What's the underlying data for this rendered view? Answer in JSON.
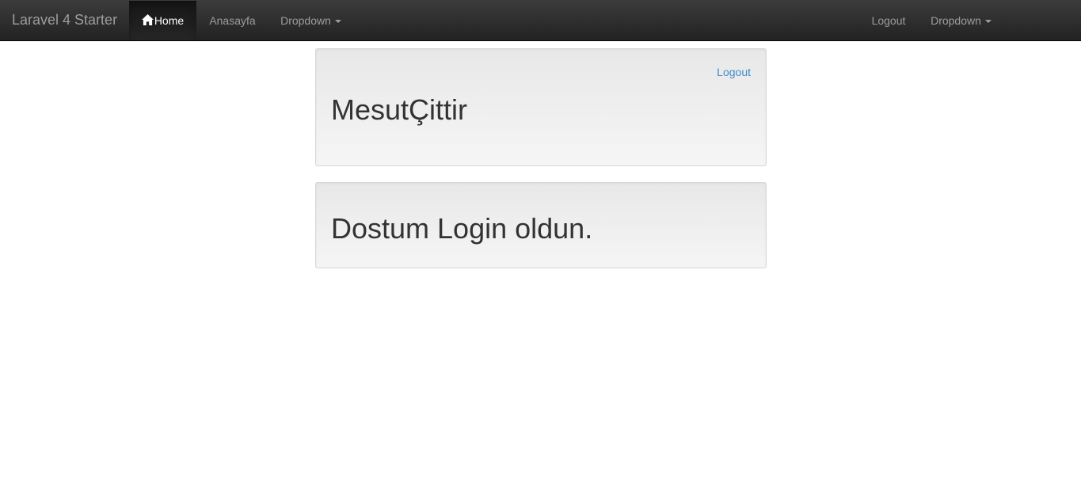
{
  "navbar": {
    "brand": "Laravel 4 Starter",
    "left_items": [
      {
        "label": "Home",
        "icon": "home-icon",
        "active": true
      },
      {
        "label": "Anasayfa"
      },
      {
        "label": "Dropdown",
        "has_caret": true
      }
    ],
    "right_items": [
      {
        "label": "Logout"
      },
      {
        "label": "Dropdown",
        "has_caret": true
      }
    ]
  },
  "panels": [
    {
      "link": "Logout",
      "heading": "MesutÇittir"
    },
    {
      "heading": "Dostum Login oldun."
    }
  ],
  "colors": {
    "navbar_bg": "#222222",
    "nav_text": "#9d9d9d",
    "active_text": "#ffffff",
    "link": "#428bca",
    "panel_bg": "#eeeeee",
    "heading_text": "#333333"
  }
}
